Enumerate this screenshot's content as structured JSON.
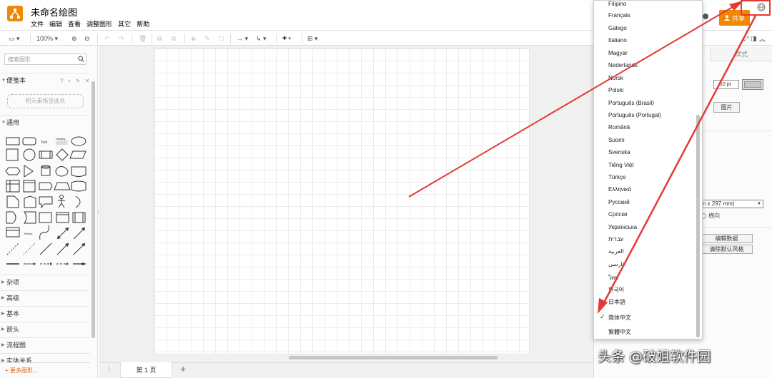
{
  "app": {
    "title": "未命名绘图",
    "menu": [
      "文件",
      "编辑",
      "查看",
      "调整图形",
      "其它",
      "帮助"
    ],
    "share_label": "共享"
  },
  "toolbar": {
    "zoom": "100%"
  },
  "sidebar": {
    "search_placeholder": "搜索图形",
    "scratchpad_title": "便笺本",
    "scratchpad_tools": "? + ✎ ✕",
    "scratchpad_drop": "把元素拖至此处",
    "general_title": "通用",
    "shape_text": "Text",
    "shape_textbox": "Textbox",
    "shape_heading": "Heading",
    "categories": [
      "杂项",
      "高级",
      "基本",
      "箭头",
      "流程图",
      "实体关系"
    ],
    "more_shapes": "+ 更多图形..."
  },
  "pages": {
    "tab": "第 1 页"
  },
  "format_panel": {
    "tab": "样式",
    "font_size": "10 pt",
    "image_button": "图片",
    "paper_size": "n x 297 mm)",
    "landscape": "横向",
    "edit_data": "编辑数据",
    "clear_style": "清除默认风格"
  },
  "language_menu": {
    "items": [
      "Filipino",
      "Français",
      "Galego",
      "Italiano",
      "Magyar",
      "Nederlands",
      "Norsk",
      "Polski",
      "Português (Brasil)",
      "Português (Portugal)",
      "Română",
      "Suomi",
      "Svenska",
      "Tiếng Việt",
      "Türkçe",
      "Ελληνικά",
      "Русский",
      "Српски",
      "Українська",
      "עברית",
      "العربية",
      "فارسی",
      "ไทย",
      "한국어",
      "日本語",
      "简体中文",
      "繁體中文"
    ],
    "selected": "简体中文",
    "check": "✓"
  },
  "watermark": "头条 @破姐软件园",
  "colors": {
    "brand": "#f08705",
    "annotation": "#e53935"
  }
}
